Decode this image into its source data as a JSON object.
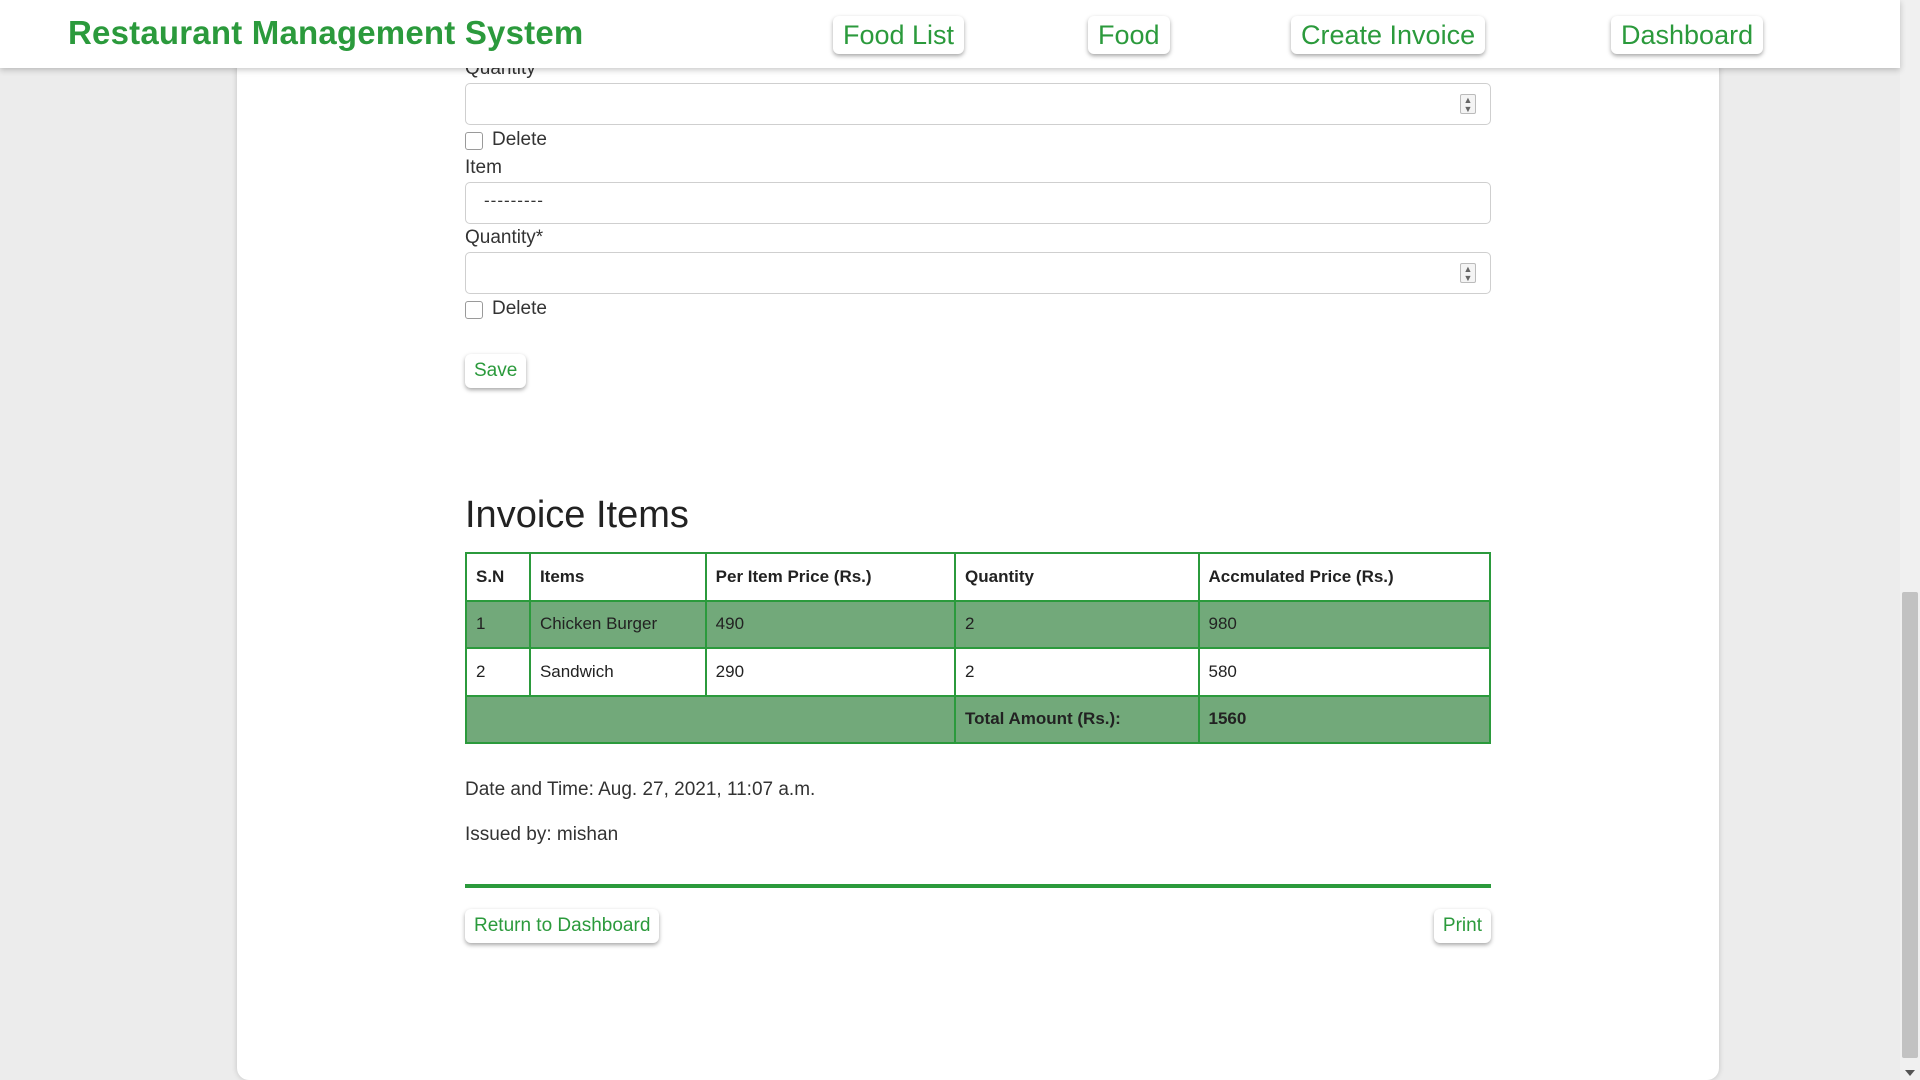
{
  "navbar": {
    "brand": "Restaurant Management System",
    "links": [
      "Food List",
      "Food",
      "Create Invoice",
      "Dashboard"
    ]
  },
  "form": {
    "quantity_label": "Quantity*",
    "delete_label": "Delete",
    "item_label": "Item",
    "item_placeholder": "---------",
    "save_label": "Save"
  },
  "invoice": {
    "title": "Invoice Items",
    "columns": [
      "S.N",
      "Items",
      "Per Item Price (Rs.)",
      "Quantity",
      "Accmulated Price (Rs.)"
    ],
    "rows": [
      [
        "1",
        "Chicken Burger",
        "490",
        "2",
        "980"
      ],
      [
        "2",
        "Sandwich",
        "290",
        "2",
        "580"
      ]
    ],
    "total_label": "Total Amount (Rs.):",
    "total_value": "1560",
    "datetime": "Date and Time: Aug. 27, 2021, 11:07 a.m.",
    "issued_by": "Issued by: mishan"
  },
  "actions": {
    "return_label": "Return to Dashboard",
    "print_label": "Print"
  },
  "colors": {
    "brand_green": "#2b9a3c",
    "row_shade": "#72a97a",
    "background": "#ececec"
  }
}
